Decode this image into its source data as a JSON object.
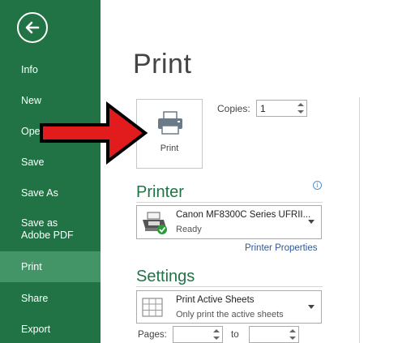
{
  "sidebar": {
    "items": [
      {
        "label": "Info"
      },
      {
        "label": "New"
      },
      {
        "label": "Ope"
      },
      {
        "label": "Save"
      },
      {
        "label": "Save As"
      },
      {
        "label": "Save as Adobe PDF"
      },
      {
        "label": "Print",
        "active": true
      },
      {
        "label": "Share"
      },
      {
        "label": "Export"
      }
    ],
    "icon": "back-arrow-icon"
  },
  "main": {
    "title": "Print",
    "print_button": {
      "label": "Print",
      "icon": "printer-icon"
    },
    "copies": {
      "label": "Copies:",
      "value": "1"
    },
    "printer": {
      "section_title": "Printer",
      "info_icon": "info-icon",
      "selected": {
        "name": "Canon MF8300C Series UFRII...",
        "status": "Ready",
        "icon": "printer-ready-icon"
      },
      "properties_link": "Printer Properties"
    },
    "settings": {
      "section_title": "Settings",
      "print_what": {
        "title": "Print Active Sheets",
        "subtitle": "Only print the active sheets",
        "icon": "sheet-grid-icon"
      },
      "pages": {
        "label": "Pages:",
        "from": "",
        "to_label": "to",
        "to": ""
      }
    }
  },
  "colors": {
    "sidebar_bg": "#217346",
    "sidebar_active": "#439467",
    "section_title": "#217346",
    "link": "#2b579a",
    "annotation_arrow": "#e21c1c"
  }
}
